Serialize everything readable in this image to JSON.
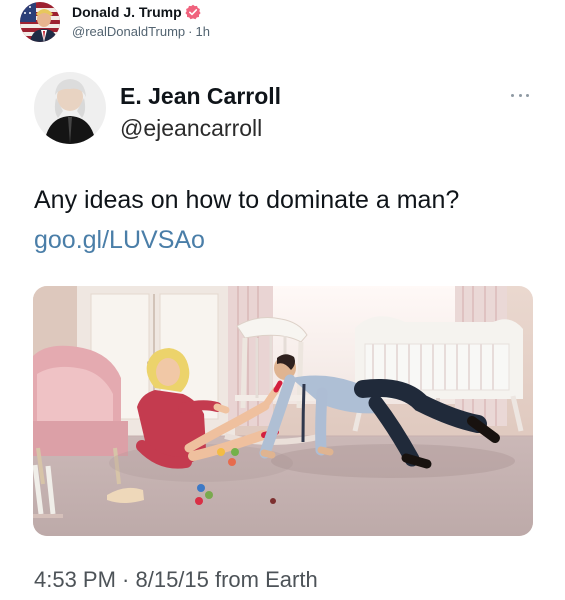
{
  "outer_post": {
    "author_name": "Donald J. Trump",
    "handle": "@realDonaldTrump",
    "separator": "·",
    "time_ago": "1h",
    "verified_color": "#f0627d"
  },
  "embedded_tweet": {
    "author_name": "E. Jean Carroll",
    "handle": "@ejeancarroll",
    "text": "Any ideas on how to dominate a man?",
    "link": "goo.gl/LUVSAo",
    "timestamp": "4:53 PM · 8/15/15 from Earth",
    "link_color": "#4a7ea8"
  },
  "icons": {
    "verified": "verified-badge-icon",
    "more": "more-options-icon"
  }
}
